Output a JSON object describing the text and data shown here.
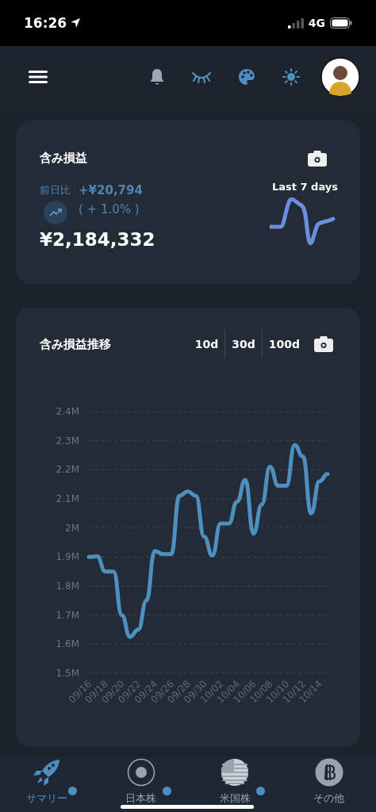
{
  "status_bar": {
    "time": "16:26",
    "network": "4G"
  },
  "summary_card": {
    "title": "含み損益",
    "compare_label": "前日比",
    "change_amount": "+¥20,794",
    "change_percent": "( + 1.0% )",
    "total": "¥2,184,332",
    "sparkline_label": "Last 7 days"
  },
  "history_card": {
    "title": "含み損益推移",
    "ranges": [
      {
        "label": "10d"
      },
      {
        "label": "30d"
      },
      {
        "label": "100d"
      }
    ],
    "chart_data": {
      "type": "line",
      "grid": true,
      "categories": [
        "09/16",
        null,
        "09/18",
        null,
        "09/20",
        null,
        "09/22",
        null,
        "09/24",
        null,
        "09/26",
        null,
        "09/28",
        null,
        "09/30",
        null,
        "10/02",
        null,
        "10/04",
        null,
        "10/06",
        null,
        "10/08",
        null,
        "10/10",
        null,
        "10/12",
        null,
        "10/14",
        null
      ],
      "series": [
        {
          "color": "#4f8fc0",
          "values": [
            1900000,
            1902000,
            1850000,
            1850000,
            1700000,
            1625000,
            1650000,
            1750000,
            1920000,
            1910000,
            1910000,
            2110000,
            2125000,
            2110000,
            1970000,
            1905000,
            2015000,
            2015000,
            2090000,
            2165000,
            1980000,
            2080000,
            2210000,
            2145000,
            2145000,
            2285000,
            2245000,
            2050000,
            2160000,
            2185000
          ]
        }
      ],
      "ylim": [
        1500000,
        2400000
      ],
      "yticks": [
        {
          "value": 1500000,
          "label": "1.5M"
        },
        {
          "value": 1600000,
          "label": "1.6M"
        },
        {
          "value": 1700000,
          "label": "1.7M"
        },
        {
          "value": 1800000,
          "label": "1.8M"
        },
        {
          "value": 1900000,
          "label": "1.9M"
        },
        {
          "value": 2000000,
          "label": "2M"
        },
        {
          "value": 2100000,
          "label": "2.1M"
        },
        {
          "value": 2200000,
          "label": "2.2M"
        },
        {
          "value": 2300000,
          "label": "2.3M"
        },
        {
          "value": 2400000,
          "label": "2.4M"
        }
      ]
    }
  },
  "bottom_nav": [
    {
      "kind": "rocket",
      "label": "サマリー",
      "selected": true,
      "badge": true
    },
    {
      "kind": "circle",
      "label": "日本株",
      "selected": false,
      "badge": true
    },
    {
      "kind": "flag",
      "label": "米国株",
      "selected": false,
      "badge": true
    },
    {
      "kind": "coin",
      "label": "その他",
      "selected": false,
      "badge": false
    }
  ]
}
